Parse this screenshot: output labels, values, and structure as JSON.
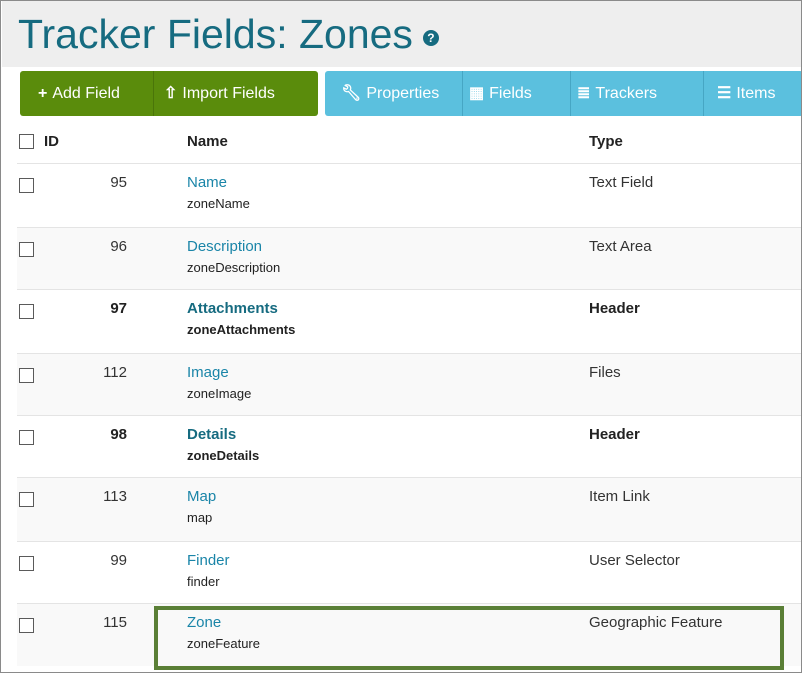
{
  "page": {
    "title": "Tracker Fields: Zones",
    "help_icon": "question-circle-icon"
  },
  "toolbar": {
    "add_field": "Add Field",
    "import_fields": "Import Fields",
    "properties": "Properties",
    "fields": "Fields",
    "trackers": "Trackers",
    "items": "Items"
  },
  "colors": {
    "title": "#166b80",
    "green_buttons": "#5a8c0c",
    "blue_buttons": "#5bc0de",
    "link": "#1a85a8",
    "highlight_border": "#5a7f36"
  },
  "table": {
    "headers": {
      "id": "ID",
      "name": "Name",
      "type": "Type"
    },
    "rows": [
      {
        "id": "95",
        "name": "Name",
        "perm": "zoneName",
        "type": "Text Field",
        "bold": false
      },
      {
        "id": "96",
        "name": "Description",
        "perm": "zoneDescription",
        "type": "Text Area",
        "bold": false
      },
      {
        "id": "97",
        "name": "Attachments",
        "perm": "zoneAttachments",
        "type": "Header",
        "bold": true
      },
      {
        "id": "112",
        "name": "Image",
        "perm": "zoneImage",
        "type": "Files",
        "bold": false
      },
      {
        "id": "98",
        "name": "Details",
        "perm": "zoneDetails",
        "type": "Header",
        "bold": true
      },
      {
        "id": "113",
        "name": "Map",
        "perm": "map",
        "type": "Item Link",
        "bold": false
      },
      {
        "id": "99",
        "name": "Finder",
        "perm": "finder",
        "type": "User Selector",
        "bold": false
      },
      {
        "id": "115",
        "name": "Zone",
        "perm": "zoneFeature",
        "type": "Geographic Feature",
        "bold": false
      }
    ]
  }
}
